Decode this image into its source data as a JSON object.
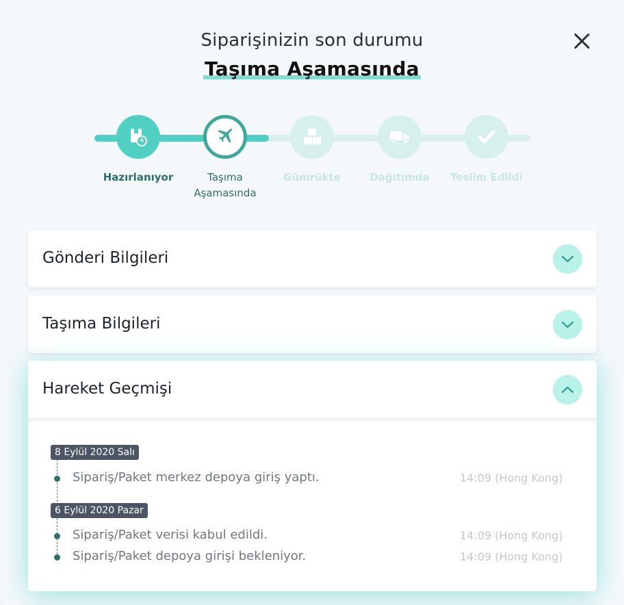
{
  "header": {
    "subtitle": "Siparişinizin son durumu",
    "title": "Taşıma Aşamasında"
  },
  "stepper": {
    "steps": [
      {
        "label": "Hazırlanıyor",
        "state": "done",
        "icon": "package-clock-icon"
      },
      {
        "label": "Taşıma Aşamasında",
        "state": "active",
        "icon": "airplane-icon"
      },
      {
        "label": "Gümrükte",
        "state": "todo",
        "icon": "boxes-icon"
      },
      {
        "label": "Dağıtımda",
        "state": "todo",
        "icon": "truck-icon"
      },
      {
        "label": "Teslim Edildi",
        "state": "todo",
        "icon": "checkmark-icon"
      }
    ]
  },
  "sections": [
    {
      "title": "Gönderi Bilgileri",
      "expanded": false
    },
    {
      "title": "Taşıma Bilgileri",
      "expanded": false
    },
    {
      "title": "Hareket Geçmişi",
      "expanded": true
    }
  ],
  "history": [
    {
      "date": "8 Eylül 2020 Salı",
      "events": [
        {
          "text": "Sipariş/Paket merkez depoya giriş yaptı.",
          "time": "14:09 (Hong Kong)"
        }
      ]
    },
    {
      "date": "6 Eylül 2020 Pazar",
      "events": [
        {
          "text": "Sipariş/Paket verisi kabul edildi.",
          "time": "14:09 (Hong Kong)"
        },
        {
          "text": "Sipariş/Paket depoya girişi bekleniyor.",
          "time": "14:09 (Hong Kong)"
        }
      ]
    }
  ],
  "colors": {
    "accent": "#4fd0c2",
    "accent_dark": "#3fa79c",
    "accent_light": "#d6f1ed",
    "badge": "#4d5565"
  }
}
